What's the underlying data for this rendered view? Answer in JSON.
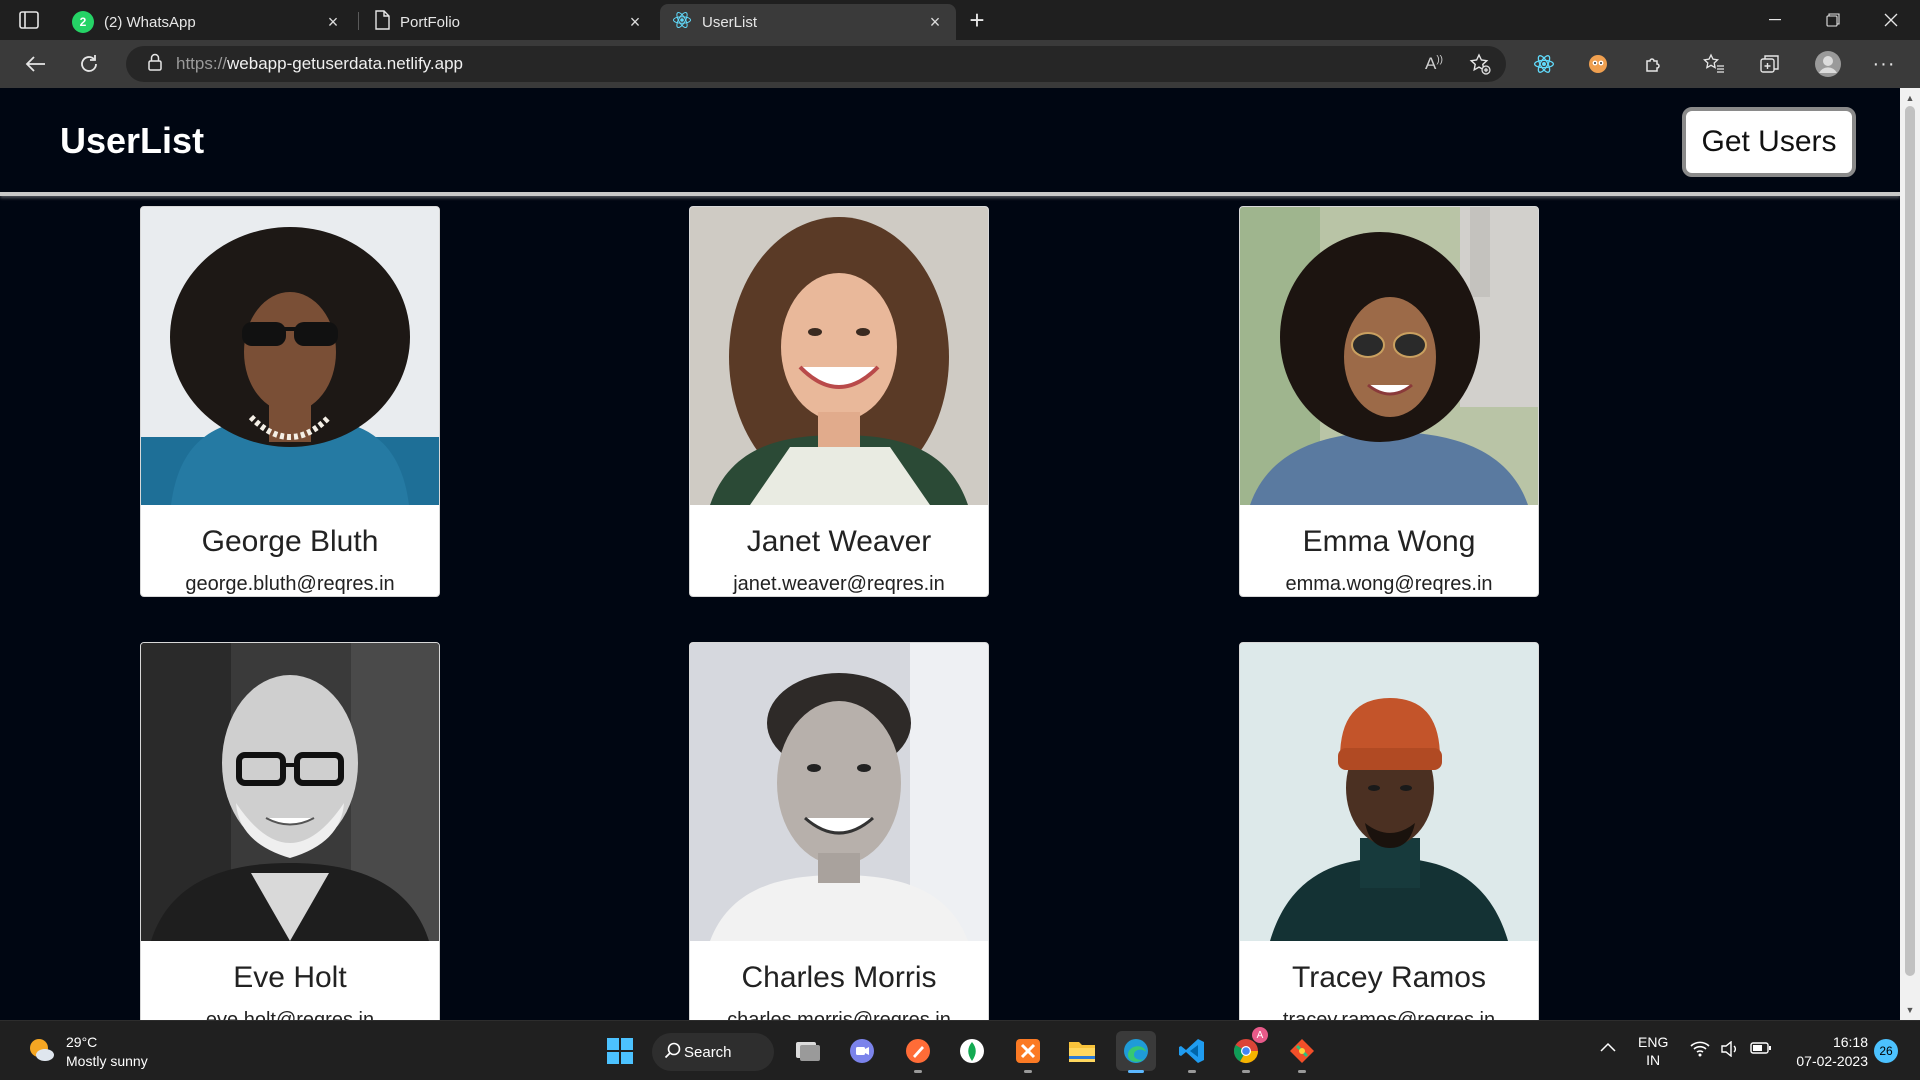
{
  "browser": {
    "tabs": [
      {
        "label": "(2) WhatsApp",
        "badge": "2",
        "icon": "whatsapp-icon",
        "active": false
      },
      {
        "label": "PortFolio",
        "icon": "document-icon",
        "active": false
      },
      {
        "label": "UserList",
        "icon": "react-icon",
        "active": true
      }
    ],
    "address": {
      "scheme": "https://",
      "host": "webapp-getuserdata.netlify.app"
    }
  },
  "app": {
    "brand": "UserList",
    "get_users_label": "Get Users",
    "users": [
      {
        "name": "George Bluth",
        "email": "george.bluth@reqres.in"
      },
      {
        "name": "Janet Weaver",
        "email": "janet.weaver@reqres.in"
      },
      {
        "name": "Emma Wong",
        "email": "emma.wong@reqres.in"
      },
      {
        "name": "Eve Holt",
        "email": "eve.holt@reqres.in"
      },
      {
        "name": "Charles Morris",
        "email": "charles.morris@reqres.in"
      },
      {
        "name": "Tracey Ramos",
        "email": "tracey.ramos@reqres.in"
      }
    ],
    "colors": {
      "background": "#000612",
      "card": "#ffffff"
    }
  },
  "taskbar": {
    "weather": {
      "temp": "29°C",
      "condition": "Mostly sunny"
    },
    "search_label": "Search",
    "lang": {
      "line1": "ENG",
      "line2": "IN"
    },
    "clock": {
      "time": "16:18",
      "date": "07-02-2023"
    },
    "notification_count": "26",
    "chrome_badge": "A"
  }
}
